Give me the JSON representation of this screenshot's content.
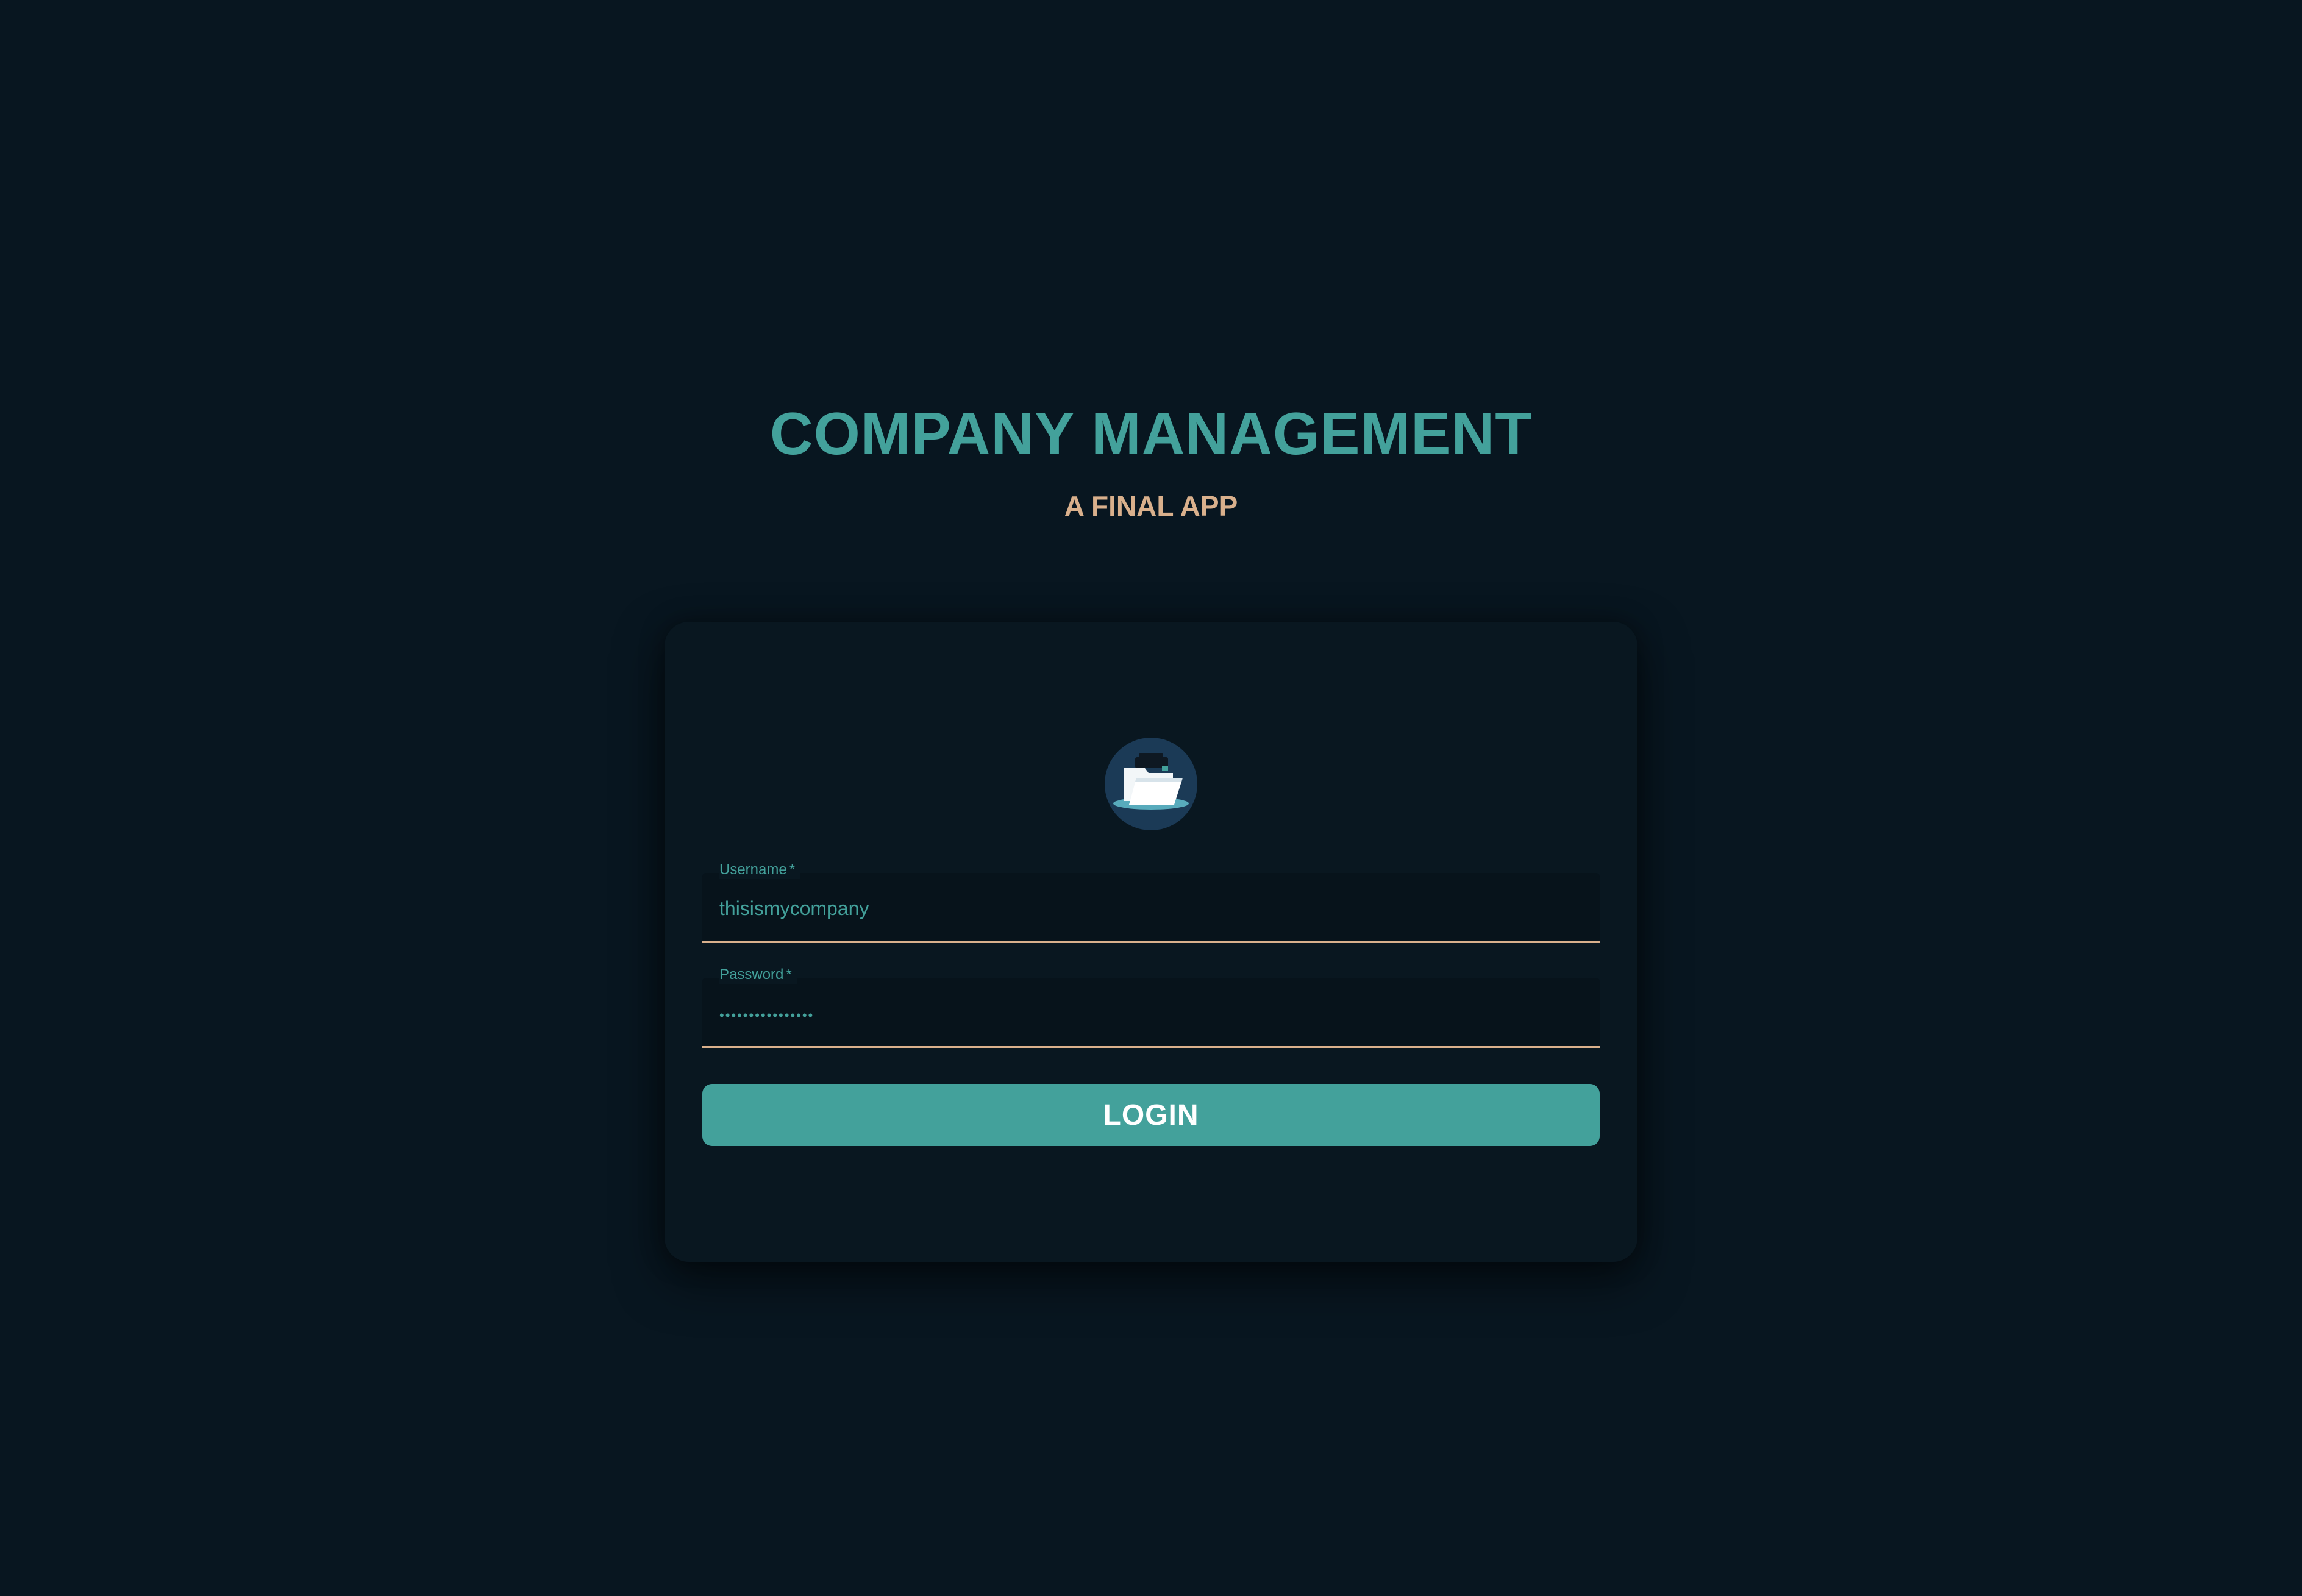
{
  "header": {
    "title": "COMPANY MANAGEMENT",
    "subtitle": "A FINAL APP"
  },
  "login_form": {
    "avatar_icon": "folder-icon",
    "username": {
      "label": "Username",
      "required_mark": "*",
      "value": "thisismycompany"
    },
    "password": {
      "label": "Password",
      "required_mark": "*",
      "masked_value": "••••••••••••••••"
    },
    "submit_label": "LOGIN"
  },
  "colors": {
    "background": "#081620",
    "card": "#091720",
    "accent": "#43A19B",
    "secondary": "#D9B08C"
  }
}
